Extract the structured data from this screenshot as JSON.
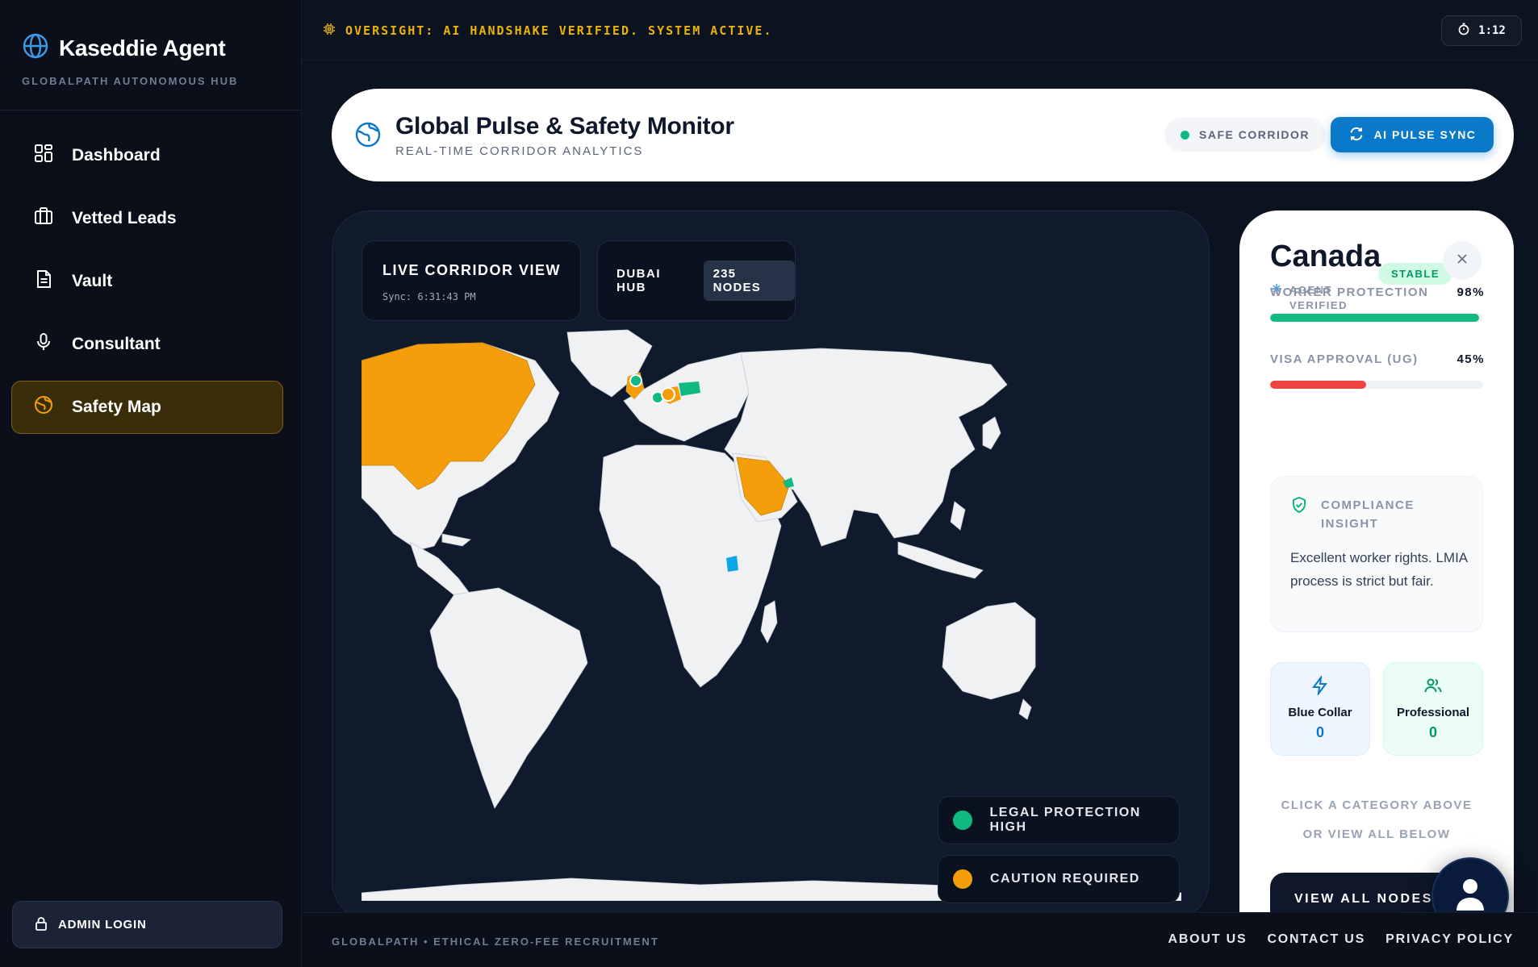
{
  "brand": {
    "title": "Kaseddie Agent",
    "subtitle": "GLOBALPATH AUTONOMOUS HUB"
  },
  "sidebar": {
    "items": [
      {
        "label": "Dashboard",
        "icon": "grid-icon"
      },
      {
        "label": "Vetted Leads",
        "icon": "briefcase-icon"
      },
      {
        "label": "Vault",
        "icon": "document-icon"
      },
      {
        "label": "Consultant",
        "icon": "microphone-icon"
      },
      {
        "label": "Safety Map",
        "icon": "globe-icon",
        "active": true
      }
    ],
    "admin_label": "ADMIN LOGIN"
  },
  "topbar": {
    "oversight": "OVERSIGHT: AI HANDSHAKE VERIFIED. SYSTEM ACTIVE.",
    "timer": "1:12"
  },
  "header": {
    "title": "Global Pulse & Safety Monitor",
    "subtitle": "REAL-TIME CORRIDOR ANALYTICS",
    "status": "SAFE CORRIDOR",
    "sync_label": "AI PULSE SYNC"
  },
  "map": {
    "live_title": "LIVE CORRIDOR VIEW",
    "sync_time": "Sync: 6:31:43 PM",
    "hub_label": "DUBAI HUB",
    "hub_nodes": "235 NODES",
    "legend": [
      {
        "label": "LEGAL PROTECTION HIGH",
        "color": "#10b981"
      },
      {
        "label": "CAUTION REQUIRED",
        "color": "#f59e0b"
      }
    ],
    "colors": {
      "land": "#f0f1f3",
      "ocean": "#0f1a2d",
      "caution": "#f59e0b",
      "safe": "#10b981",
      "hub": "#0ea5e9"
    }
  },
  "detail": {
    "country": "Canada",
    "status_badge": "STABLE",
    "verified": "AGENT VERIFIED",
    "metrics": [
      {
        "label": "WORKER PROTECTION",
        "value": "98%",
        "fraction": 0.98,
        "color": "#10b981"
      },
      {
        "label": "VISA APPROVAL (UG)",
        "value": "45%",
        "fraction": 0.45,
        "color": "#ef4444"
      }
    ],
    "insight_title": "COMPLIANCE INSIGHT",
    "insight_body": "Excellent worker rights. LMIA process is strict but fair.",
    "categories": [
      {
        "label": "Blue Collar",
        "count": "0",
        "icon": "lightning-icon",
        "color": "#0a79c9"
      },
      {
        "label": "Professional",
        "count": "0",
        "icon": "users-icon",
        "color": "#059669"
      }
    ],
    "hint_line1": "CLICK A CATEGORY ABOVE",
    "hint_line2": "OR VIEW ALL BELOW",
    "view_all": "VIEW ALL NODES"
  },
  "footer": {
    "left": "GLOBALPATH • ETHICAL ZERO-FEE RECRUITMENT",
    "links": [
      "ABOUT US",
      "CONTACT US",
      "PRIVACY POLICY"
    ]
  }
}
